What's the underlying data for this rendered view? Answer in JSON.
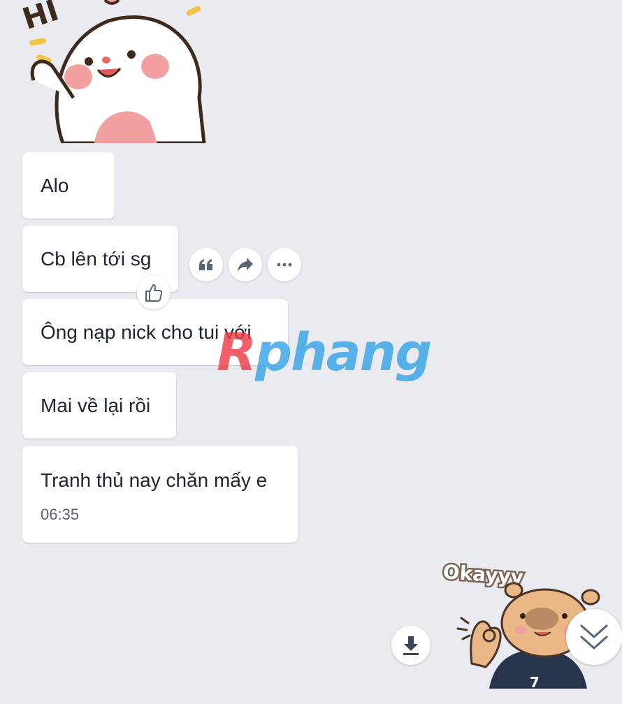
{
  "messages": [
    {
      "text": "Alo"
    },
    {
      "text": "Cb lên tới sg"
    },
    {
      "text": "Ông nạp nick cho tui với"
    },
    {
      "text": "Mai về lại rồi"
    },
    {
      "text": "Tranh thủ nay chăn mấy e",
      "time": "06:35"
    }
  ],
  "stickers": {
    "top": {
      "text": "HI",
      "icon": "bunny-hi-sticker"
    },
    "bottom": {
      "text": "Okayyy",
      "icon": "capybara-okay-sticker"
    }
  },
  "actions": [
    "quote-icon",
    "forward-icon",
    "more-icon"
  ],
  "reaction": "thumbs-up-icon",
  "watermark": {
    "r": "R",
    "rest": "phang"
  }
}
